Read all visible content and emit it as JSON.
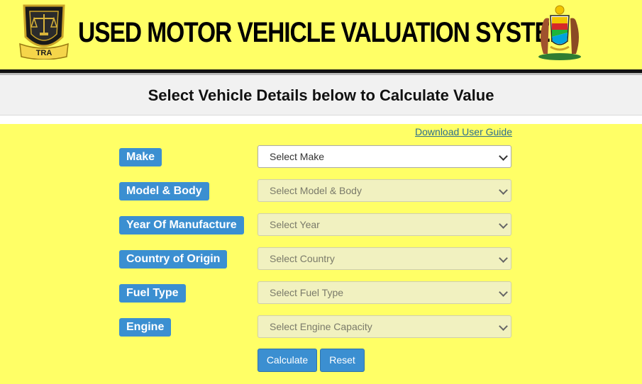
{
  "header": {
    "title": "USED MOTOR VEHICLE VALUATION SYSTEM",
    "logo_left_text": "TRA"
  },
  "subheader": {
    "title": "Select Vehicle Details below to Calculate Value"
  },
  "links": {
    "user_guide": "Download User Guide"
  },
  "form": {
    "fields": [
      {
        "label": "Make",
        "placeholder": "Select Make",
        "enabled": true
      },
      {
        "label": "Model & Body",
        "placeholder": "Select Model & Body",
        "enabled": false
      },
      {
        "label": "Year Of Manufacture",
        "placeholder": "Select Year",
        "enabled": false
      },
      {
        "label": "Country of Origin",
        "placeholder": "Select Country",
        "enabled": false
      },
      {
        "label": "Fuel Type",
        "placeholder": "Select Fuel Type",
        "enabled": false
      },
      {
        "label": "Engine",
        "placeholder": "Select Engine Capacity",
        "enabled": false
      }
    ],
    "calculate_label": "Calculate",
    "reset_label": "Reset"
  },
  "colors": {
    "page_background": "#ffff66",
    "label_background": "#3b8fd1",
    "disabled_select": "#f1f1c0"
  }
}
